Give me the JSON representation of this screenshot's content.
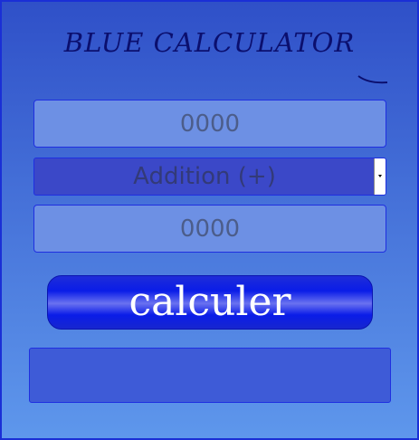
{
  "app": {
    "title": "BLUE CALCULATOR"
  },
  "form": {
    "first_number": {
      "value": "",
      "placeholder": "0000"
    },
    "operation": {
      "selected": "Addition (+)"
    },
    "second_number": {
      "value": "",
      "placeholder": "0000"
    },
    "submit_label": "calculer",
    "result": ""
  },
  "colors": {
    "background_top": "#2f50c8",
    "background_bottom": "#5e97ec",
    "button": "#0a1ce8",
    "title": "#0b0f6e"
  },
  "icons": {
    "select_arrow": "chevron-down-icon"
  }
}
